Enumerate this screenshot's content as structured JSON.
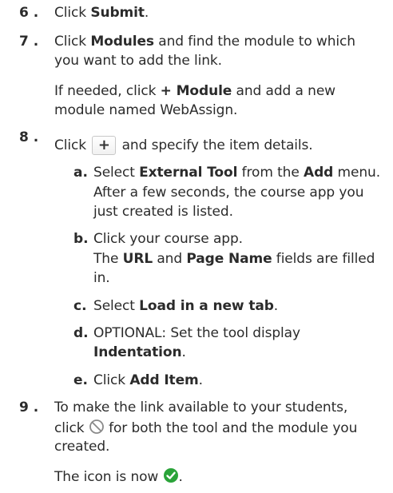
{
  "steps": {
    "s6": {
      "num": "6 .",
      "t1": "Click ",
      "b1": "Submit",
      "t2": "."
    },
    "s7": {
      "num": "7 .",
      "t1": "Click ",
      "b1": "Modules",
      "t2": " and find the module to which",
      "line2": "you want to add the link.",
      "note_t1": "If needed, click ",
      "note_b1": "+ Module",
      "note_t2": " and add a new",
      "note_line2": "module named WebAssign."
    },
    "s8": {
      "num": "8 .",
      "t1": "Click ",
      "button_label": "+",
      "t2": " and specify the item details.",
      "a": {
        "letter": "a.",
        "t1": "Select ",
        "b1": "External Tool",
        "t2": " from the ",
        "b2": "Add",
        "t3": " menu.",
        "note_line1": "After a few seconds, the course app you",
        "note_line2": "just created is listed."
      },
      "b": {
        "letter": "b.",
        "t1": "Click your course app.",
        "note_t1": "The ",
        "note_b1": "URL",
        "note_t2": " and ",
        "note_b2": "Page Name",
        "note_t3": " fields are filled",
        "note_line2": "in."
      },
      "c": {
        "letter": "c.",
        "t1": "Select ",
        "b1": "Load in a new tab",
        "t2": "."
      },
      "d": {
        "letter": "d.",
        "t1": "OPTIONAL: Set the tool display",
        "b1": "Indentation",
        "t2": "."
      },
      "e": {
        "letter": "e.",
        "t1": "Click ",
        "b1": "Add Item",
        "t2": "."
      }
    },
    "s9": {
      "num": "9 .",
      "line1": "To make the link available to your students,",
      "t1": "click ",
      "t2": " for both the tool and the module you",
      "line3": "created.",
      "note_t1": "The icon is now ",
      "note_t2": "."
    }
  },
  "icons": {
    "unpublished": "unpublished-circle-icon",
    "published": "published-check-icon"
  },
  "colors": {
    "text": "#2b2b2b",
    "unpublished": "#8a8a8a",
    "published": "#2aa339"
  }
}
